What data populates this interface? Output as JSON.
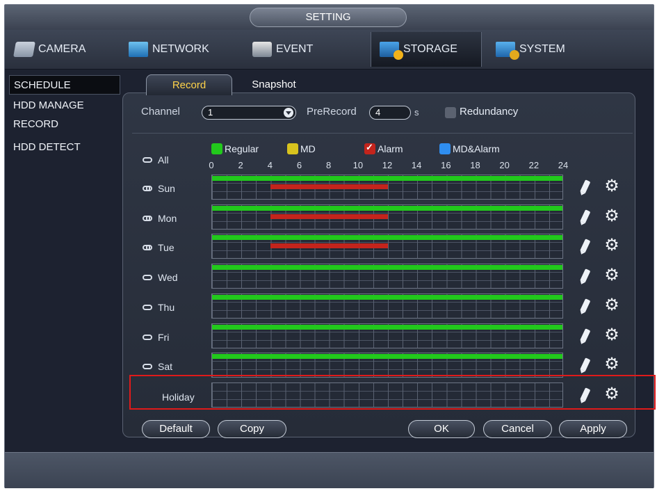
{
  "window": {
    "title": "SETTING"
  },
  "main_tabs": [
    {
      "label": "CAMERA",
      "icon": "camera-icon"
    },
    {
      "label": "NETWORK",
      "icon": "network-icon"
    },
    {
      "label": "EVENT",
      "icon": "event-icon"
    },
    {
      "label": "STORAGE",
      "icon": "storage-icon",
      "active": true
    },
    {
      "label": "SYSTEM",
      "icon": "system-icon"
    }
  ],
  "sidebar": {
    "items": [
      {
        "label": "SCHEDULE",
        "active": true
      },
      {
        "label": "HDD MANAGE"
      },
      {
        "label": "RECORD"
      },
      {
        "label": "HDD DETECT"
      }
    ]
  },
  "sub_tabs": {
    "record": "Record",
    "snapshot": "Snapshot",
    "active": "Record"
  },
  "form": {
    "channel_label": "Channel",
    "channel_value": "1",
    "prerecord_label": "PreRecord",
    "prerecord_value": "4",
    "prerecord_unit": "s",
    "redundancy_label": "Redundancy",
    "redundancy_checked": false
  },
  "legend": [
    {
      "label": "Regular",
      "color": "#22c91c",
      "checked": false
    },
    {
      "label": "MD",
      "color": "#d8c31e",
      "checked": false
    },
    {
      "label": "Alarm",
      "color": "#c3241c",
      "checked": true
    },
    {
      "label": "MD&Alarm",
      "color": "#2f8ef0",
      "checked": false
    }
  ],
  "all_label": "All",
  "hours": [
    "0",
    "2",
    "4",
    "6",
    "8",
    "10",
    "12",
    "14",
    "16",
    "18",
    "20",
    "22",
    "24"
  ],
  "days": [
    {
      "label": "Sun",
      "linked": true,
      "regular": [
        [
          0,
          24
        ]
      ],
      "alarm": [
        [
          4,
          12
        ]
      ]
    },
    {
      "label": "Mon",
      "linked": true,
      "regular": [
        [
          0,
          24
        ]
      ],
      "alarm": [
        [
          4,
          12
        ]
      ]
    },
    {
      "label": "Tue",
      "linked": true,
      "regular": [
        [
          0,
          24
        ]
      ],
      "alarm": [
        [
          4,
          12
        ]
      ]
    },
    {
      "label": "Wed",
      "linked": false,
      "regular": [
        [
          0,
          24
        ]
      ],
      "alarm": []
    },
    {
      "label": "Thu",
      "linked": false,
      "regular": [
        [
          0,
          24
        ]
      ],
      "alarm": []
    },
    {
      "label": "Fri",
      "linked": false,
      "regular": [
        [
          0,
          24
        ]
      ],
      "alarm": []
    },
    {
      "label": "Sat",
      "linked": false,
      "regular": [
        [
          0,
          24
        ]
      ],
      "alarm": []
    }
  ],
  "holiday": {
    "label": "Holiday",
    "regular": [],
    "alarm": []
  },
  "buttons": {
    "default": "Default",
    "copy": "Copy",
    "ok": "OK",
    "cancel": "Cancel",
    "apply": "Apply"
  },
  "colors": {
    "highlight": "#e01a1a",
    "active_tab_text": "#ffd34a"
  }
}
